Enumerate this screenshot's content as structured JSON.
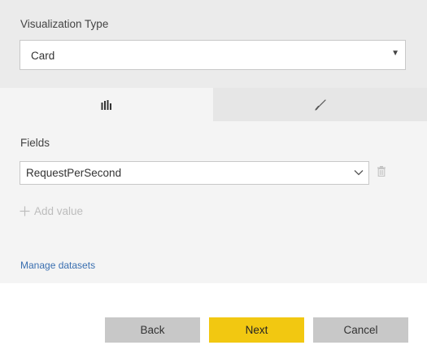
{
  "visualization": {
    "label": "Visualization Type",
    "selected": "Card",
    "arrow": "▼"
  },
  "tabs": [
    {
      "icon": "bar-chart-icon",
      "active": true
    },
    {
      "icon": "paintbrush-icon",
      "active": false
    }
  ],
  "fields": {
    "label": "Fields",
    "selected": "RequestPerSecond",
    "add_value_label": "Add value"
  },
  "links": {
    "manage_datasets": "Manage datasets"
  },
  "buttons": {
    "back": "Back",
    "next": "Next",
    "cancel": "Cancel"
  },
  "colors": {
    "accent": "#f2c811",
    "link": "#3a6fb0",
    "panel_bg": "#f4f4f4",
    "header_bg": "#ebebeb",
    "button_gray": "#c8c8c8"
  }
}
